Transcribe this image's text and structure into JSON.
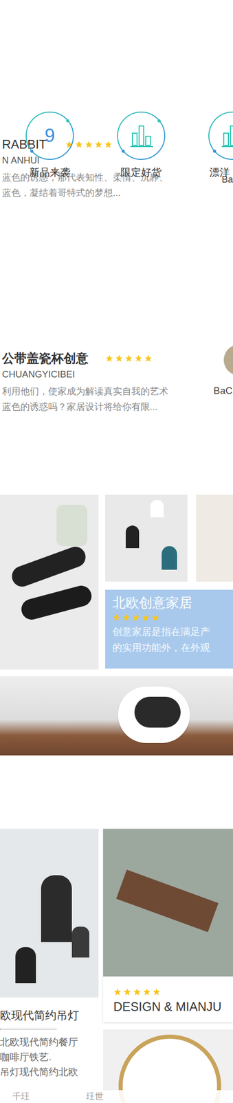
{
  "nav": [
    {
      "icon_text": "9",
      "label": "新品来袭"
    },
    {
      "label": "限定好货"
    },
    {
      "label": "漂洋"
    }
  ],
  "articles": [
    {
      "title": "RABBIT",
      "stars": 5,
      "subtitle": "N ANHUI",
      "lines": [
        "蓝色的诱惑，那代表知性、柔情、沉静、",
        "蓝色，凝结着哥特式的梦想..."
      ],
      "author": "Ba"
    },
    {
      "title": "公带盖瓷杯创意",
      "stars": 5,
      "subtitle": "CHUANGYICIBEI",
      "lines": [
        "利用他们，使家成为解读真实自我的艺术",
        "蓝色的诱惑吗？家居设计将给你有限..."
      ],
      "author": "BaC"
    }
  ],
  "feature": {
    "title": "北欧创意家居",
    "stars": 5,
    "lines": [
      "创意家居是指在满足产",
      "的实用功能外，在外观"
    ]
  },
  "products": [
    {
      "title": "欧现代简约吊灯",
      "lines": [
        "北欧现代简约餐厅",
        "咖啡厅铁艺.",
        "吊灯现代简约北欧"
      ]
    },
    {
      "title": "DESIGN & MIANJU",
      "stars": 5
    }
  ],
  "tabbar": [
    "千玨",
    "玨世"
  ]
}
